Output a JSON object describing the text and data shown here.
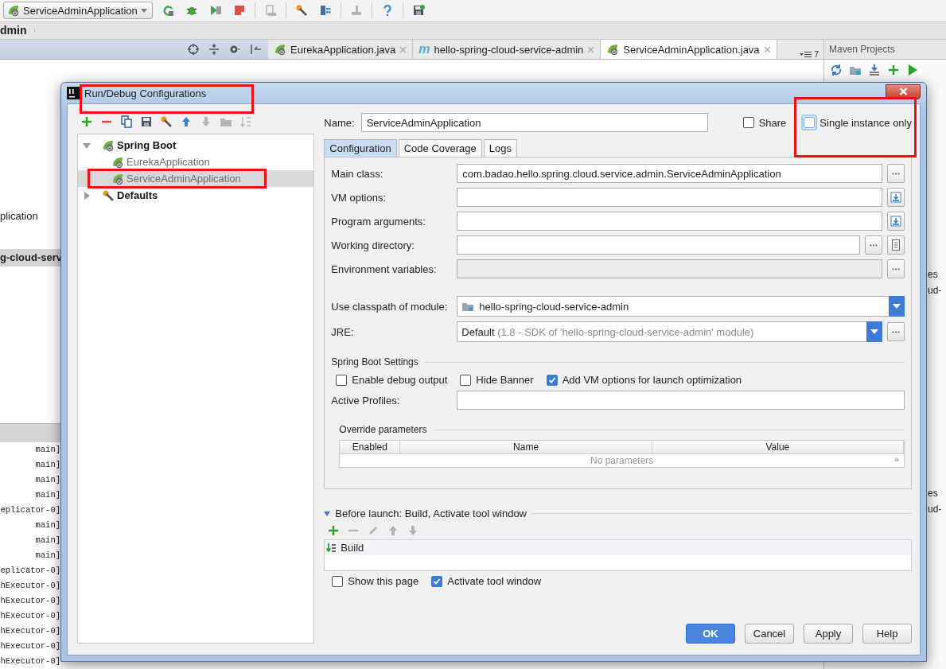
{
  "toolbar": {
    "run_config": "ServiceAdminApplication",
    "icons": [
      {
        "disabled": false
      },
      {
        "disabled": false
      },
      {
        "disabled": false
      },
      {
        "disabled": false
      },
      {
        "disabled": true
      },
      {
        "disabled": false
      },
      {
        "disabled": false
      },
      {
        "disabled": true
      },
      {
        "disabled": false
      },
      {
        "disabled": false
      }
    ]
  },
  "breadcrumb": "dmin",
  "project_panel": {
    "items": [
      "plication",
      "g-cloud-serv"
    ]
  },
  "editor_tabs": [
    {
      "label": "EurekaApplication.java",
      "selected": false
    },
    {
      "label": "hello-spring-cloud-service-admin",
      "glyph": "m",
      "selected": false
    },
    {
      "label": "ServiceAdminApplication.java",
      "selected": true
    }
  ],
  "tab_overflow": "7",
  "maven": {
    "title": "Maven Projects",
    "items": [
      "es",
      "ud-",
      "es",
      "ud-"
    ]
  },
  "console_lines": [
    "main]",
    "main]",
    "main]",
    "main]",
    "eplicator-0]",
    "main]",
    "main]",
    "main]",
    "eplicator-0]",
    "hExecutor-0]",
    "hExecutor-0]",
    "hExecutor-0]",
    "hExecutor-0]",
    "hExecutor-0]",
    "hExecutor-0]"
  ],
  "dialog": {
    "title": "Run/Debug Configurations",
    "toolbar": [
      {
        "disabled": false
      },
      {
        "disabled": false
      },
      {
        "disabled": false
      },
      {
        "disabled": false
      },
      {
        "disabled": false
      },
      {
        "disabled": false
      },
      {
        "disabled": true
      },
      {
        "disabled": true
      },
      {
        "disabled": true
      }
    ],
    "tree": [
      {
        "label": "Spring Boot",
        "kind": "group",
        "expanded": true,
        "selected": false,
        "children": [
          {
            "label": "EurekaApplication",
            "kind": "config",
            "selected": false
          },
          {
            "label": "ServiceAdminApplication",
            "kind": "config",
            "selected": true
          }
        ]
      },
      {
        "label": "Defaults",
        "kind": "defaults",
        "expanded": false,
        "selected": false
      }
    ],
    "name_label": "Name:",
    "name_value": "ServiceAdminApplication",
    "share": {
      "label": "Share",
      "checked": false
    },
    "single_instance": {
      "label": "Single instance only",
      "checked": false,
      "focused": true
    },
    "tabs": [
      {
        "label": "Configuration",
        "selected": true
      },
      {
        "label": "Code Coverage",
        "selected": false
      },
      {
        "label": "Logs",
        "selected": false
      }
    ],
    "fields": [
      {
        "label": "Main class:",
        "kind": "text",
        "value": "com.badao.hello.spring.cloud.service.admin.ServiceAdminApplication"
      },
      {
        "label": "VM options:",
        "kind": "text"
      },
      {
        "label": "Program arguments:",
        "kind": "text"
      },
      {
        "label": "Working directory:",
        "kind": "text"
      },
      {
        "label": "Environment variables:",
        "kind": "disabled"
      },
      {
        "label": "Use classpath of module:",
        "kind": "module",
        "value": "hello-spring-cloud-service-admin"
      },
      {
        "label": "JRE:",
        "kind": "jre",
        "value": "Default",
        "hint": "(1.8 - SDK of 'hello-spring-cloud-service-admin' module)"
      }
    ],
    "spring_settings": {
      "title": "Spring Boot Settings",
      "options": [
        {
          "label": "Enable debug output",
          "checked": false
        },
        {
          "label": "Hide Banner",
          "checked": false
        },
        {
          "label": "Add VM options for launch optimization",
          "checked": true
        }
      ],
      "profiles_label": "Active Profiles:"
    },
    "override": {
      "title": "Override parameters",
      "columns": [
        "Enabled",
        "Name",
        "Value"
      ],
      "empty": "No parameters",
      "more": "»"
    },
    "before_launch": {
      "title": "Before launch: Build, Activate tool window",
      "expanded": true,
      "toolbar": [
        {
          "disabled": false
        },
        {
          "disabled": true
        },
        {
          "disabled": true
        },
        {
          "disabled": true
        },
        {
          "disabled": true
        }
      ],
      "tasks": [
        "Build"
      ]
    },
    "bottom_options": [
      {
        "label": "Show this page",
        "checked": false
      },
      {
        "label": "Activate tool window",
        "checked": true
      }
    ],
    "buttons": [
      {
        "label": "OK",
        "kind": "primary"
      },
      {
        "label": "Cancel",
        "kind": "normal"
      },
      {
        "label": "Apply",
        "kind": "normal"
      },
      {
        "label": "Help",
        "kind": "normal"
      }
    ]
  }
}
